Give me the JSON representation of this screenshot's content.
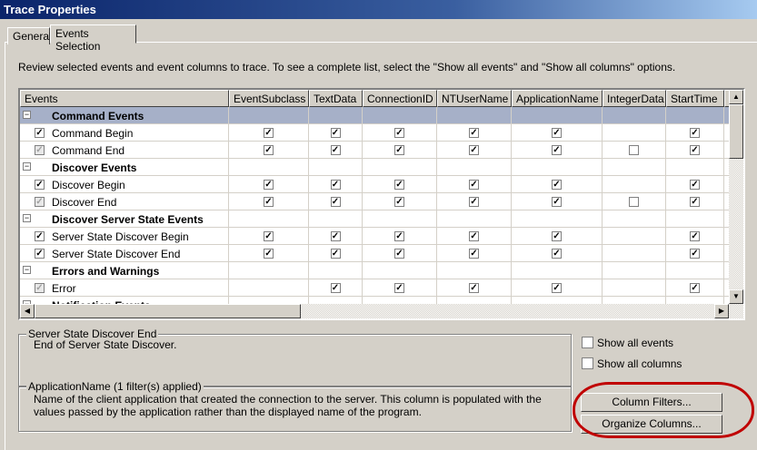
{
  "window": {
    "title": "Trace Properties"
  },
  "tabs": [
    {
      "label": "General"
    },
    {
      "label": "Events Selection",
      "active": true
    }
  ],
  "instructions": "Review selected events and event columns to trace. To see a complete list, select the \"Show all events\" and \"Show all columns\" options.",
  "columns": [
    "Events",
    "EventSubclass",
    "TextData",
    "ConnectionID",
    "NTUserName",
    "ApplicationName",
    "IntegerData",
    "StartTime"
  ],
  "rows": [
    {
      "type": "category",
      "label": "Command Events",
      "selected": true
    },
    {
      "type": "event",
      "label": "Command Begin",
      "check": "checked",
      "cells": [
        "c",
        "c",
        "c",
        "c",
        "c",
        "",
        "c"
      ]
    },
    {
      "type": "event",
      "label": "Command End",
      "check": "grayed",
      "cells": [
        "c",
        "c",
        "c",
        "c",
        "c",
        "u",
        "c"
      ]
    },
    {
      "type": "category",
      "label": "Discover Events"
    },
    {
      "type": "event",
      "label": "Discover Begin",
      "check": "checked",
      "cells": [
        "c",
        "c",
        "c",
        "c",
        "c",
        "",
        "c"
      ]
    },
    {
      "type": "event",
      "label": "Discover End",
      "check": "grayed",
      "cells": [
        "c",
        "c",
        "c",
        "c",
        "c",
        "u",
        "c"
      ]
    },
    {
      "type": "category",
      "label": "Discover Server State Events"
    },
    {
      "type": "event",
      "label": "Server State Discover Begin",
      "check": "checked",
      "cells": [
        "c",
        "c",
        "c",
        "c",
        "c",
        "",
        "c"
      ]
    },
    {
      "type": "event",
      "label": "Server State Discover End",
      "check": "checked",
      "cells": [
        "c",
        "c",
        "c",
        "c",
        "c",
        "",
        "c"
      ]
    },
    {
      "type": "category",
      "label": "Errors and Warnings"
    },
    {
      "type": "event",
      "label": "Error",
      "check": "grayed",
      "cells": [
        "",
        "c",
        "c",
        "c",
        "c",
        "",
        "c"
      ]
    },
    {
      "type": "category",
      "label": "Notification Events"
    }
  ],
  "event_desc": {
    "title": "Server State Discover End",
    "text": "End of Server State Discover."
  },
  "column_desc": {
    "title": "ApplicationName (1 filter(s) applied)",
    "text": "Name of the client application that created the connection to the server. This column is populated with the values passed by the application rather than the displayed name of the program."
  },
  "options": {
    "show_all_events": "Show all events",
    "show_all_columns": "Show all columns"
  },
  "buttons": {
    "column_filters": "Column Filters...",
    "organize_columns": "Organize Columns..."
  },
  "colors": {
    "highlight_ellipse": "#c00000",
    "selected_row": "#a6b0c8"
  }
}
